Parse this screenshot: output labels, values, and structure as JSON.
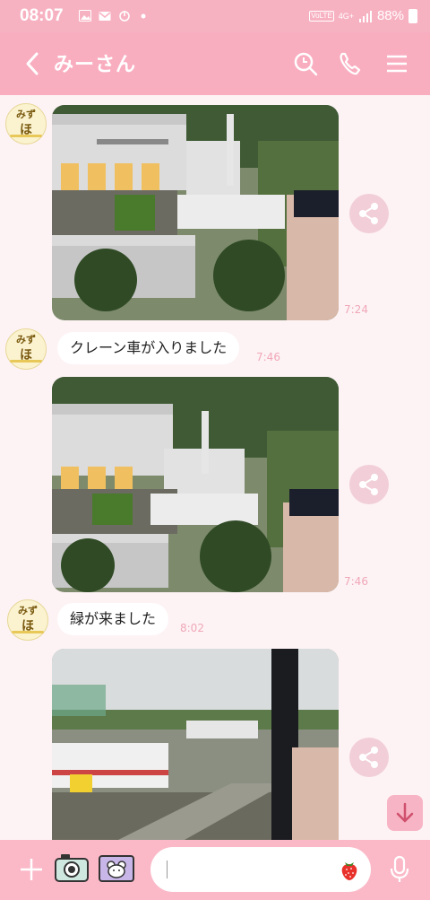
{
  "status_bar": {
    "time": "08:07",
    "network": "4G+",
    "volte": "VoLTE",
    "battery": "88%"
  },
  "header": {
    "title": "みーさん"
  },
  "avatar": {
    "line1": "みず",
    "line2": "ほ"
  },
  "messages": [
    {
      "type": "image",
      "time": "7:24"
    },
    {
      "type": "text",
      "text": "クレーン車が入りました",
      "time": "7:46"
    },
    {
      "type": "image",
      "time": "7:46"
    },
    {
      "type": "text",
      "text": "緑が来ました",
      "time": "8:02"
    },
    {
      "type": "image",
      "time": ""
    }
  ],
  "input": {
    "placeholder": ""
  },
  "colors": {
    "header": "#f9aec0",
    "status": "#f7b2c2",
    "background": "#fdf3f5",
    "footer": "#fbb9c8",
    "accent": "#f0a7b8"
  }
}
